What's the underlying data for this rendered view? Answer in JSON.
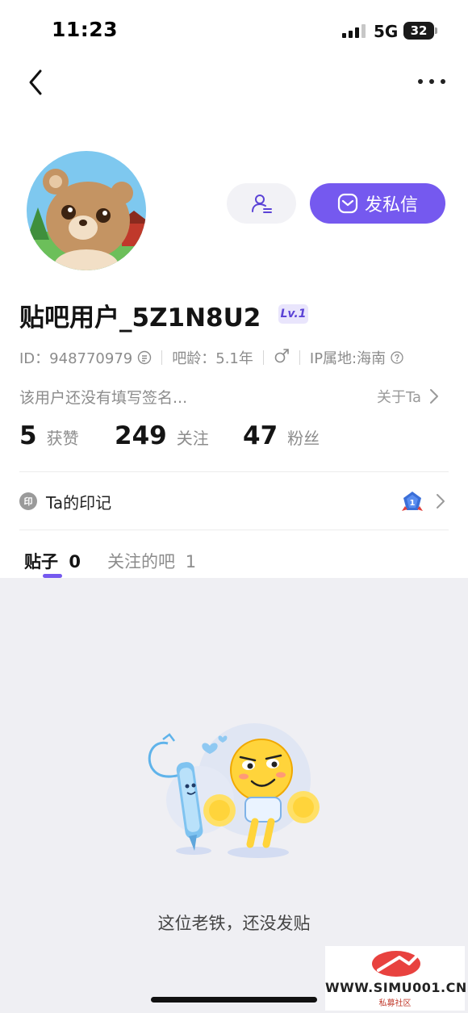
{
  "status_bar": {
    "time": "11:23",
    "network": "5G",
    "battery": "32"
  },
  "nav": {
    "back_icon": "chevron-left-icon",
    "more_icon": "more-horizontal-icon"
  },
  "profile": {
    "username": "贴吧用户_5Z1N8U2",
    "level": "Lv.1",
    "id_text": "ID：948770979",
    "age_text": "吧龄：5.1年",
    "gender_icon": "male-icon",
    "ip_text": "IP属地:海南",
    "bio": "该用户还没有填写签名...",
    "about_link": "关于Ta"
  },
  "actions": {
    "follow_icon": "add-user-icon",
    "message_label": "发私信",
    "message_icon": "message-icon"
  },
  "stats": [
    {
      "value": "5",
      "label": "获赞"
    },
    {
      "value": "249",
      "label": "关注"
    },
    {
      "value": "47",
      "label": "粉丝"
    }
  ],
  "marks": {
    "icon_label": "印",
    "label": "Ta的印记"
  },
  "tabs": [
    {
      "label": "贴子",
      "count": "0"
    },
    {
      "label": "关注的吧",
      "count": "1"
    }
  ],
  "empty_state": {
    "message": "这位老铁，还没发贴"
  },
  "watermark": {
    "text": "WWW.SIMU001.CN",
    "sub": "私募社区"
  },
  "colors": {
    "accent": "#7559ef",
    "background_empty": "#efeff3",
    "secondary_text": "#8c8c8c"
  }
}
